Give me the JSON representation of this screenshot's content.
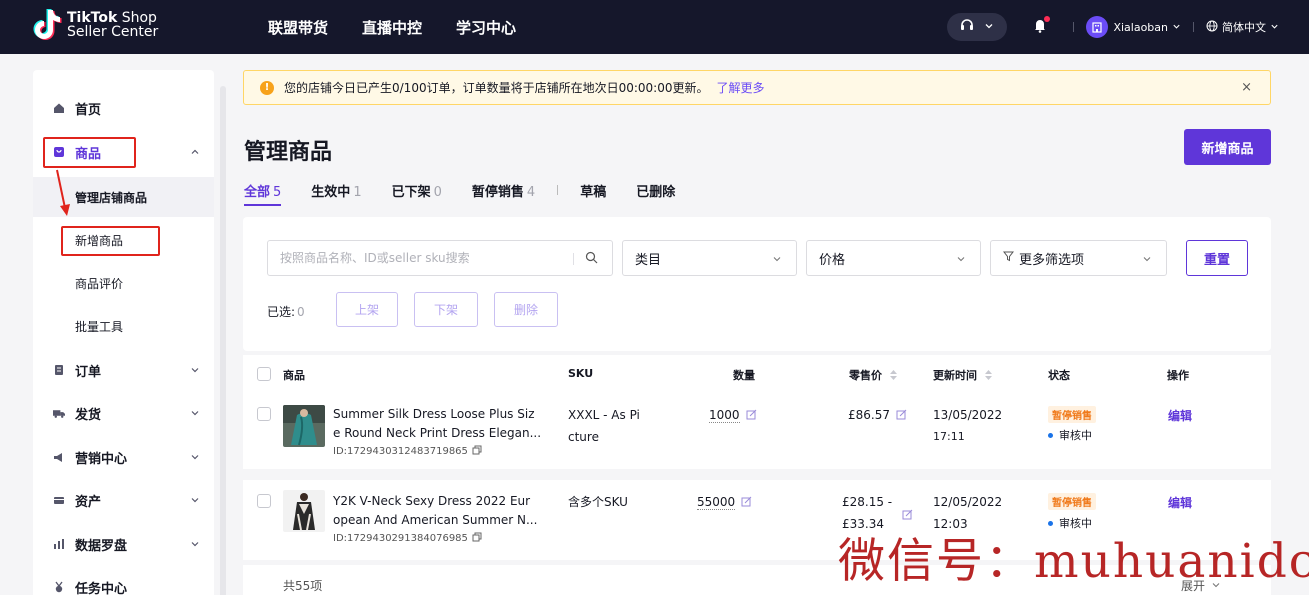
{
  "header": {
    "logo_line1_bold": "TikTok",
    "logo_line1_rest": " Shop",
    "logo_line2": "Seller Center",
    "nav": [
      "联盟带货",
      "直播中控",
      "学习中心"
    ],
    "user_name": "Xialaoban",
    "language": "简体中文"
  },
  "sidebar": {
    "home": "首页",
    "products": "商品",
    "sub": [
      "管理店铺商品",
      "新增商品",
      "商品评价",
      "批量工具"
    ],
    "orders": "订单",
    "shipping": "发货",
    "marketing": "营销中心",
    "assets": "资产",
    "data": "数据罗盘",
    "tasks": "任务中心"
  },
  "notice": {
    "text": "您的店铺今日已产生0/100订单，订单数量将于店铺所在地次日00:00:00更新。",
    "link": "了解更多",
    "close": "×"
  },
  "page": {
    "title": "管理商品",
    "add_button": "新增商品"
  },
  "tabs": [
    {
      "label": "全部",
      "count": "5"
    },
    {
      "label": "生效中",
      "count": "1"
    },
    {
      "label": "已下架",
      "count": "0"
    },
    {
      "label": "暂停销售",
      "count": "4"
    },
    {
      "label": "草稿",
      "count": ""
    },
    {
      "label": "已删除",
      "count": ""
    }
  ],
  "filters": {
    "search_placeholder": "按照商品名称、ID或seller sku搜索",
    "category": "类目",
    "price": "价格",
    "more": "更多筛选项",
    "reset": "重置",
    "selected_label": "已选:",
    "selected_count": "0",
    "btn_online": "上架",
    "btn_offline": "下架",
    "btn_delete": "删除"
  },
  "table": {
    "headers": {
      "product": "商品",
      "sku": "SKU",
      "qty": "数量",
      "price": "零售价",
      "updated": "更新时间",
      "status": "状态",
      "action": "操作"
    },
    "rows": [
      {
        "name_line1": "Summer Silk Dress Loose Plus Siz",
        "name_line2": "e Round Neck Print Dress Elegan...",
        "id": "ID:1729430312483719865",
        "sku_line1": "XXXL - As Pi",
        "sku_line2": "cture",
        "qty": "1000",
        "price_line1": "£86.57",
        "price_line2": "",
        "date": "13/05/2022",
        "time": "17:11",
        "status": "暂停销售",
        "review": "审核中",
        "action": "编辑"
      },
      {
        "name_line1": "Y2K V-Neck Sexy Dress 2022 Eur",
        "name_line2": "opean And American Summer N...",
        "id": "ID:1729430291384076985",
        "sku_line1": "含多个SKU",
        "sku_line2": "",
        "qty": "55000",
        "price_line1": "£28.15 -",
        "price_line2": "£33.34",
        "date": "12/05/2022",
        "time": "12:03",
        "status": "暂停销售",
        "review": "审核中",
        "action": "编辑"
      }
    ],
    "total": "共55项",
    "expand": "展开"
  },
  "watermark": "微信号：muhuanidc",
  "colors": {
    "topbar": "#15172b",
    "brand": "#5f36d9",
    "highlight_box": "#e0241c",
    "status_orange": "#f07a1b"
  }
}
